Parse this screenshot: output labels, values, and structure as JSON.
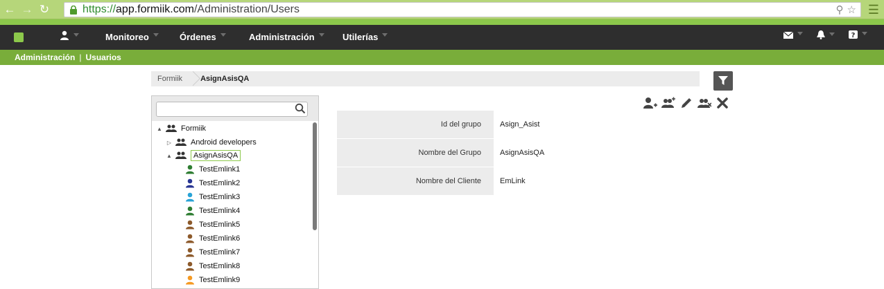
{
  "browser": {
    "url_scheme": "https://",
    "url_host": "app.formiik.com",
    "url_path": "/Administration/Users"
  },
  "topnav": {
    "items": [
      {
        "label": "Monitoreo"
      },
      {
        "label": "Órdenes"
      },
      {
        "label": "Administración"
      },
      {
        "label": "Utilerías"
      }
    ]
  },
  "breadcrumb": {
    "section": "Administración",
    "separator": "|",
    "page": "Usuarios"
  },
  "path": {
    "root": "Formiik",
    "current": "AsignAsisQA"
  },
  "tree": {
    "search_value": "",
    "root": {
      "label": "Formiik",
      "expanded": true
    },
    "groups": [
      {
        "label": "Android developers",
        "expanded": false
      },
      {
        "label": "AsignAsisQA",
        "expanded": true,
        "selected": true
      }
    ],
    "users": [
      {
        "label": "TestEmlink1",
        "color": "#2e7d32"
      },
      {
        "label": "TestEmlink2",
        "color": "#283593"
      },
      {
        "label": "TestEmlink3",
        "color": "#29a3d6"
      },
      {
        "label": "TestEmlink4",
        "color": "#2e7d32"
      },
      {
        "label": "TestEmlink5",
        "color": "#8d5a2b"
      },
      {
        "label": "TestEmlink6",
        "color": "#8d5a2b"
      },
      {
        "label": "TestEmlink7",
        "color": "#8d5a2b"
      },
      {
        "label": "TestEmlink8",
        "color": "#8d5a2b"
      },
      {
        "label": "TestEmlink9",
        "color": "#f59a23"
      }
    ]
  },
  "details": [
    {
      "label": "Id del grupo",
      "value": "Asign_Asist"
    },
    {
      "label": "Nombre del Grupo",
      "value": "AsignAsisQA"
    },
    {
      "label": "Nombre del Cliente",
      "value": "EmLink"
    }
  ],
  "colors": {
    "brand_green": "#8cc84b",
    "nav_dark": "#2e2e2e",
    "crumb_green": "#79ad3a"
  }
}
